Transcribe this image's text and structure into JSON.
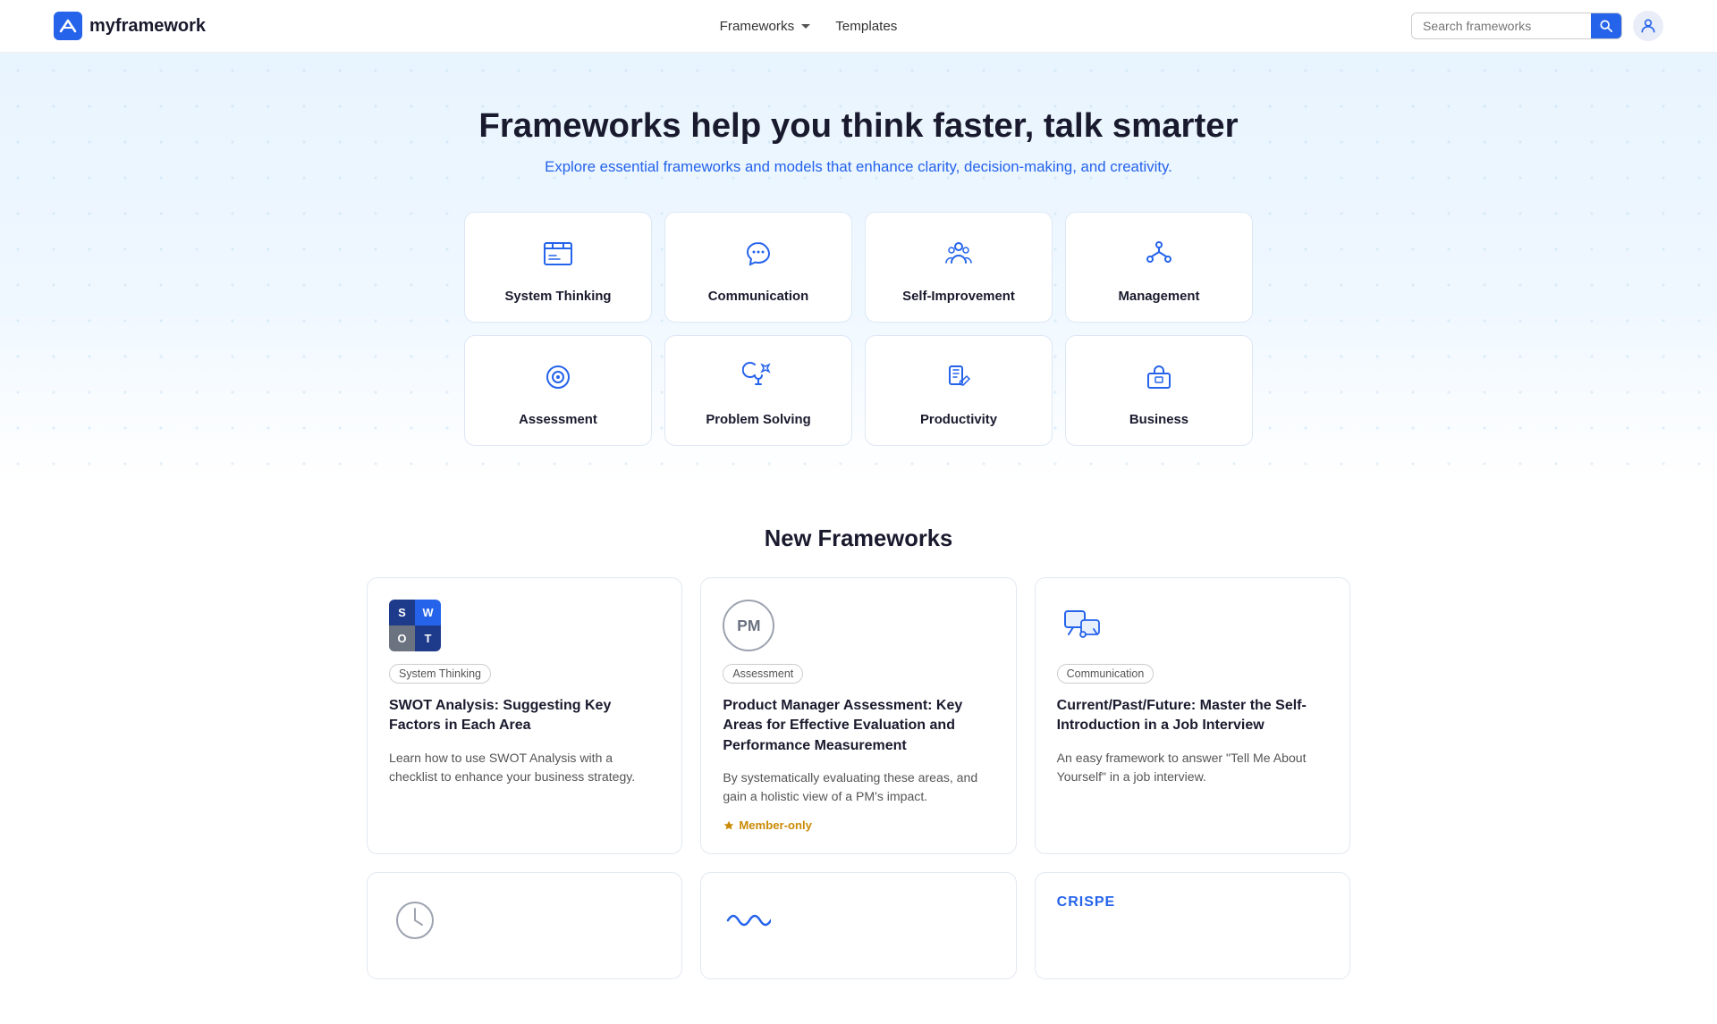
{
  "nav": {
    "logo_text": "myframework",
    "links": [
      {
        "label": "Frameworks",
        "has_dropdown": true
      },
      {
        "label": "Templates",
        "has_dropdown": false
      }
    ],
    "search_placeholder": "Search frameworks"
  },
  "hero": {
    "title": "Frameworks help you think faster, talk smarter",
    "subtitle": "Explore essential frameworks and models that enhance clarity, decision-making, and creativity."
  },
  "categories": [
    {
      "label": "System Thinking",
      "icon": "📖"
    },
    {
      "label": "Communication",
      "icon": "💬"
    },
    {
      "label": "Self-Improvement",
      "icon": "👥"
    },
    {
      "label": "Management",
      "icon": "🏢"
    },
    {
      "label": "Assessment",
      "icon": "🎯"
    },
    {
      "label": "Problem Solving",
      "icon": "🔧"
    },
    {
      "label": "Productivity",
      "icon": "⚡"
    },
    {
      "label": "Business",
      "icon": "💼"
    }
  ],
  "new_section_title": "New Frameworks",
  "frameworks": [
    {
      "badge": "System Thinking",
      "title": "SWOT Analysis: Suggesting Key Factors in Each Area",
      "description": "Learn how to use SWOT Analysis with a checklist to enhance your business strategy.",
      "thumb_type": "swot",
      "member_only": false
    },
    {
      "badge": "Assessment",
      "title": "Product Manager Assessment: Key Areas for Effective Evaluation and Performance Measurement",
      "description": "By systematically evaluating these areas, and gain a holistic view of a PM's impact.",
      "thumb_type": "pm",
      "member_only": true,
      "member_label": "Member-only"
    },
    {
      "badge": "Communication",
      "title": "Current/Past/Future: Master the Self-Introduction in a Job Interview",
      "description": "An easy framework to answer \"Tell Me About Yourself\" in a job interview.",
      "thumb_type": "comm",
      "member_only": false
    }
  ],
  "partial_frameworks": [
    {
      "thumb_type": "clock"
    },
    {
      "thumb_type": "wave"
    },
    {
      "badge": "CRISPE",
      "thumb_type": "text"
    }
  ]
}
